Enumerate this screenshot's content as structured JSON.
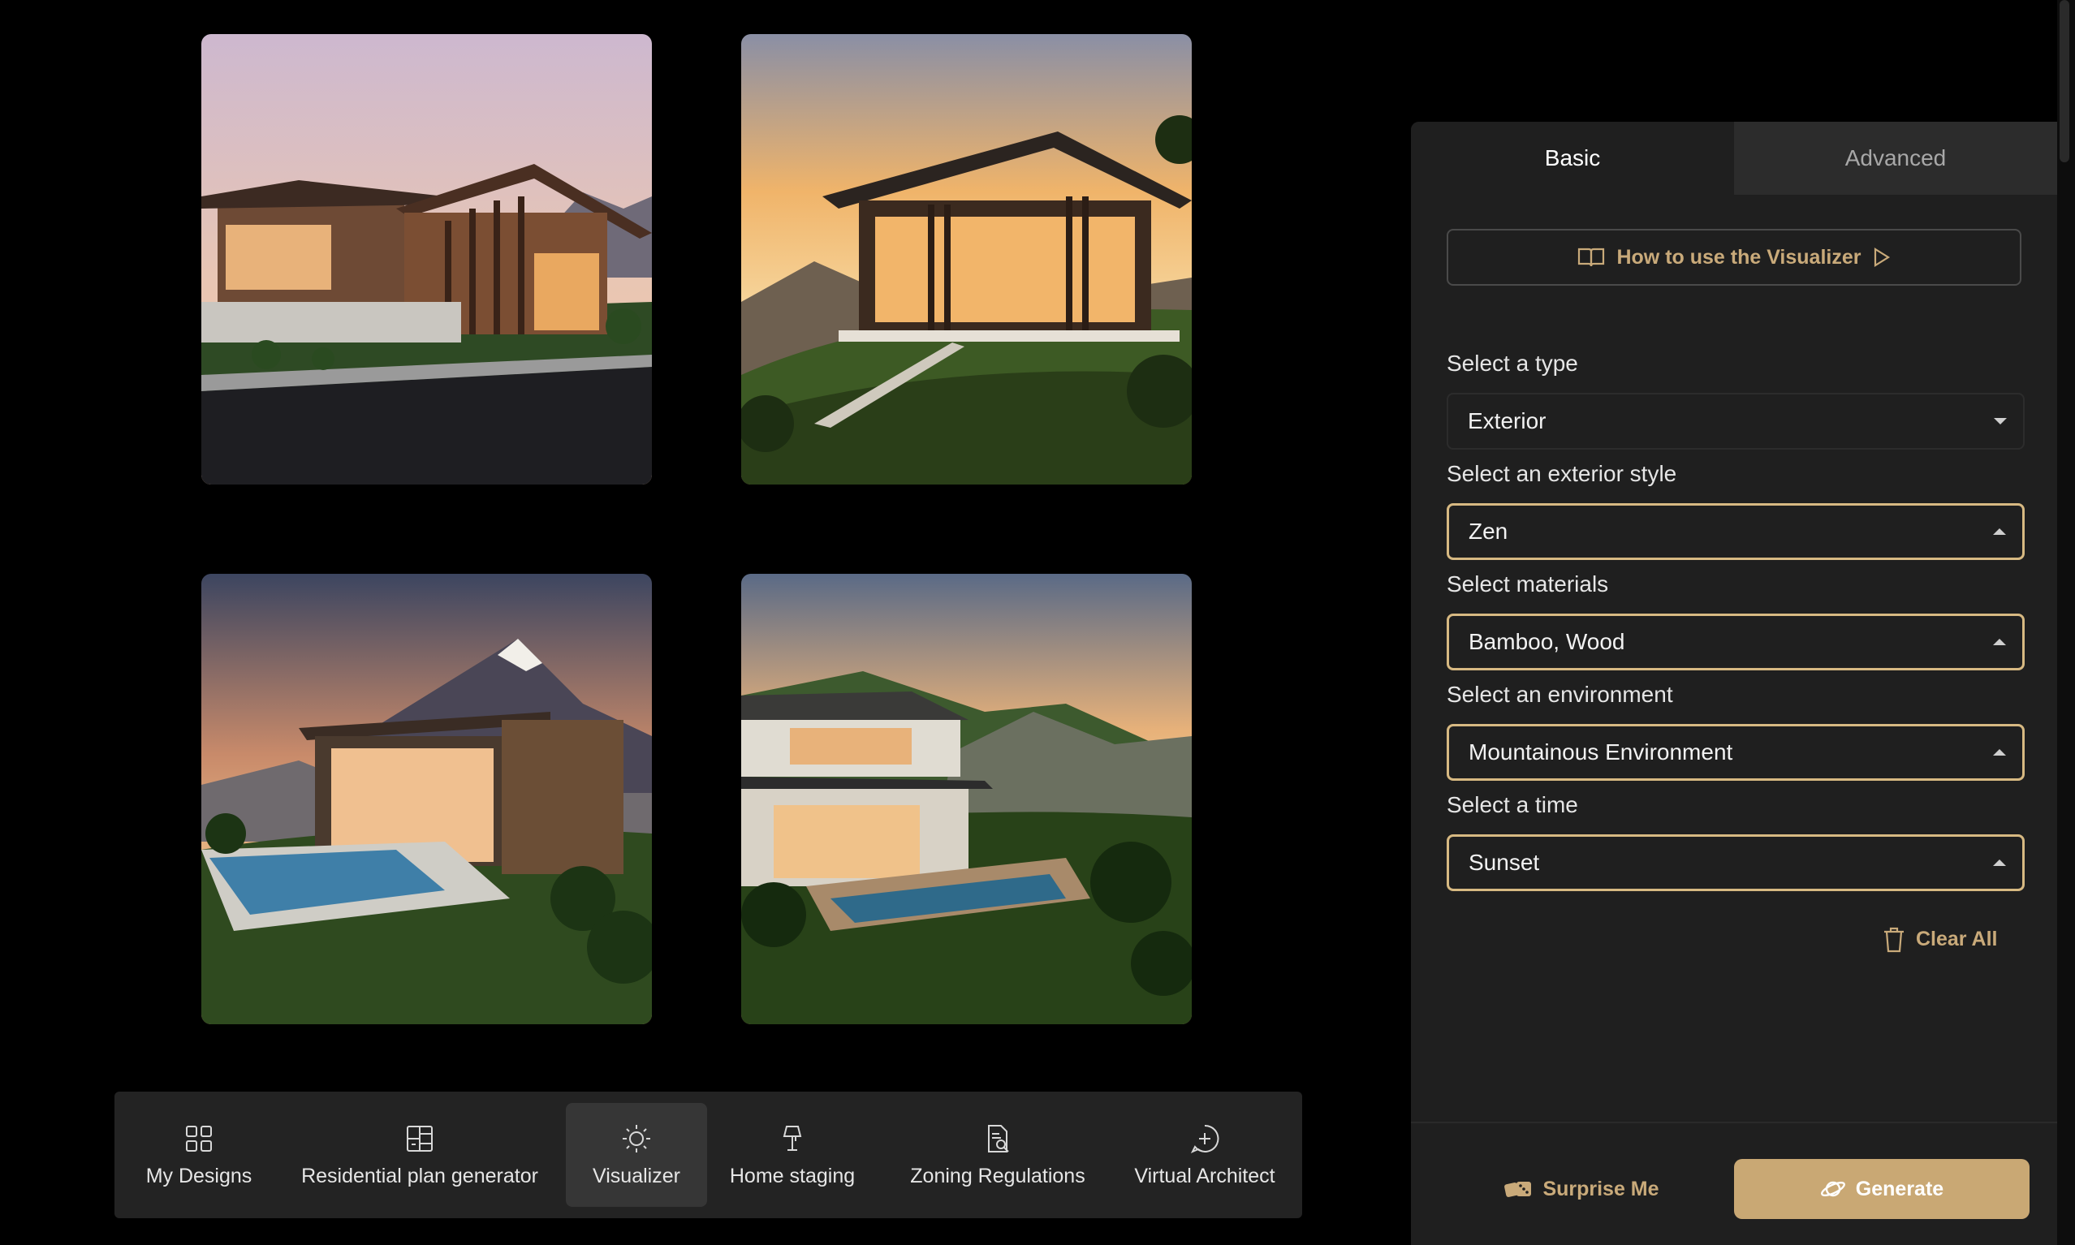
{
  "gallery": {
    "images": [
      {
        "description": "Modern timber house at dusk with gable roof and lawn"
      },
      {
        "description": "Cantilevered glass pavilion on hillside at sunset"
      },
      {
        "description": "Flat-roof villa with pool below snowy mountain peak"
      },
      {
        "description": "Two-storey zen house with pool in forested mountains"
      }
    ]
  },
  "bottom_nav": {
    "items": [
      {
        "label": "My Designs",
        "icon": "grid-icon"
      },
      {
        "label": "Residential plan generator",
        "icon": "floorplan-icon"
      },
      {
        "label": "Visualizer",
        "icon": "sun-icon",
        "active": true
      },
      {
        "label": "Home staging",
        "icon": "lamp-icon"
      },
      {
        "label": "Zoning Regulations",
        "icon": "document-search-icon"
      },
      {
        "label": "Virtual Architect",
        "icon": "chat-plus-icon"
      }
    ]
  },
  "panel": {
    "tabs": {
      "basic": "Basic",
      "advanced": "Advanced",
      "active": "basic"
    },
    "howto_label": "How to use the Visualizer",
    "fields": {
      "type": {
        "label": "Select a type",
        "value": "Exterior"
      },
      "style": {
        "label": "Select an exterior style",
        "value": "Zen"
      },
      "materials": {
        "label": "Select materials",
        "value": "Bamboo, Wood"
      },
      "environment": {
        "label": "Select an environment",
        "value": "Mountainous Environment"
      },
      "time": {
        "label": "Select a time",
        "value": "Sunset"
      }
    },
    "clear_all_label": "Clear All",
    "surprise_label": "Surprise Me",
    "generate_label": "Generate"
  },
  "colors": {
    "accent": "#c9a874",
    "accent_text": "#c9aa7a",
    "panel_bg": "#1f1f1f",
    "nav_bg": "#232323",
    "page_bg": "#000000"
  }
}
